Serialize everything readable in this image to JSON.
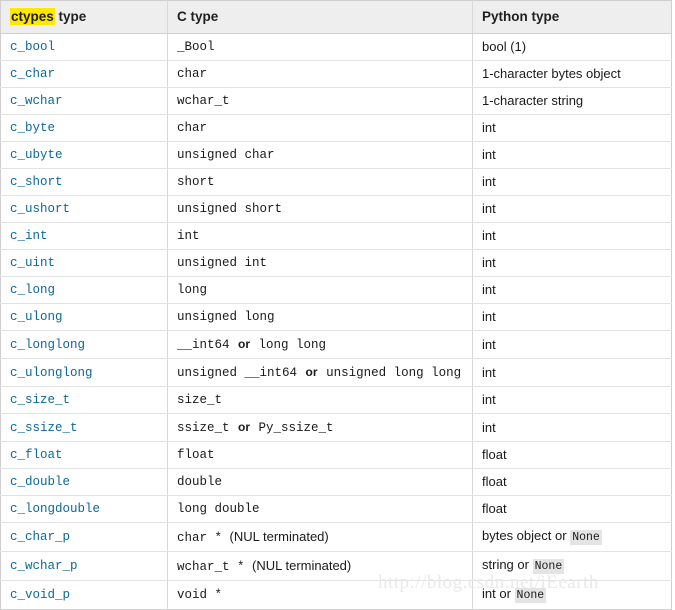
{
  "table": {
    "headers": {
      "col1_highlight": "ctypes",
      "col1_rest": " type",
      "col2": "C type",
      "col3": "Python type"
    },
    "rows": [
      {
        "ctypes": "c_bool",
        "ctype_mono": "_Bool",
        "ctype_or": "",
        "ctype_mono2": "",
        "ctype_plain": "",
        "python": "bool (1)",
        "python_or": "",
        "python_code": ""
      },
      {
        "ctypes": "c_char",
        "ctype_mono": "char",
        "ctype_or": "",
        "ctype_mono2": "",
        "ctype_plain": "",
        "python": "1-character bytes object",
        "python_or": "",
        "python_code": ""
      },
      {
        "ctypes": "c_wchar",
        "ctype_mono": "wchar_t",
        "ctype_or": "",
        "ctype_mono2": "",
        "ctype_plain": "",
        "python": "1-character string",
        "python_or": "",
        "python_code": ""
      },
      {
        "ctypes": "c_byte",
        "ctype_mono": "char",
        "ctype_or": "",
        "ctype_mono2": "",
        "ctype_plain": "",
        "python": "int",
        "python_or": "",
        "python_code": ""
      },
      {
        "ctypes": "c_ubyte",
        "ctype_mono": "unsigned char",
        "ctype_or": "",
        "ctype_mono2": "",
        "ctype_plain": "",
        "python": "int",
        "python_or": "",
        "python_code": ""
      },
      {
        "ctypes": "c_short",
        "ctype_mono": "short",
        "ctype_or": "",
        "ctype_mono2": "",
        "ctype_plain": "",
        "python": "int",
        "python_or": "",
        "python_code": ""
      },
      {
        "ctypes": "c_ushort",
        "ctype_mono": "unsigned short",
        "ctype_or": "",
        "ctype_mono2": "",
        "ctype_plain": "",
        "python": "int",
        "python_or": "",
        "python_code": ""
      },
      {
        "ctypes": "c_int",
        "ctype_mono": "int",
        "ctype_or": "",
        "ctype_mono2": "",
        "ctype_plain": "",
        "python": "int",
        "python_or": "",
        "python_code": ""
      },
      {
        "ctypes": "c_uint",
        "ctype_mono": "unsigned int",
        "ctype_or": "",
        "ctype_mono2": "",
        "ctype_plain": "",
        "python": "int",
        "python_or": "",
        "python_code": ""
      },
      {
        "ctypes": "c_long",
        "ctype_mono": "long",
        "ctype_or": "",
        "ctype_mono2": "",
        "ctype_plain": "",
        "python": "int",
        "python_or": "",
        "python_code": ""
      },
      {
        "ctypes": "c_ulong",
        "ctype_mono": "unsigned long",
        "ctype_or": "",
        "ctype_mono2": "",
        "ctype_plain": "",
        "python": "int",
        "python_or": "",
        "python_code": ""
      },
      {
        "ctypes": "c_longlong",
        "ctype_mono": "__int64",
        "ctype_or": "or",
        "ctype_mono2": "long long",
        "ctype_plain": "",
        "python": "int",
        "python_or": "",
        "python_code": ""
      },
      {
        "ctypes": "c_ulonglong",
        "ctype_mono": "unsigned __int64",
        "ctype_or": "or",
        "ctype_mono2": "unsigned long long",
        "ctype_plain": "",
        "python": "int",
        "python_or": "",
        "python_code": ""
      },
      {
        "ctypes": "c_size_t",
        "ctype_mono": "size_t",
        "ctype_or": "",
        "ctype_mono2": "",
        "ctype_plain": "",
        "python": "int",
        "python_or": "",
        "python_code": ""
      },
      {
        "ctypes": "c_ssize_t",
        "ctype_mono": "ssize_t",
        "ctype_or": "or",
        "ctype_mono2": "Py_ssize_t",
        "ctype_plain": "",
        "python": "int",
        "python_or": "",
        "python_code": ""
      },
      {
        "ctypes": "c_float",
        "ctype_mono": "float",
        "ctype_or": "",
        "ctype_mono2": "",
        "ctype_plain": "",
        "python": "float",
        "python_or": "",
        "python_code": ""
      },
      {
        "ctypes": "c_double",
        "ctype_mono": "double",
        "ctype_or": "",
        "ctype_mono2": "",
        "ctype_plain": "",
        "python": "float",
        "python_or": "",
        "python_code": ""
      },
      {
        "ctypes": "c_longdouble",
        "ctype_mono": "long double",
        "ctype_or": "",
        "ctype_mono2": "",
        "ctype_plain": "",
        "python": "float",
        "python_or": "",
        "python_code": ""
      },
      {
        "ctypes": "c_char_p",
        "ctype_mono": "char *",
        "ctype_or": "",
        "ctype_mono2": "",
        "ctype_plain": "(NUL terminated)",
        "python": "bytes object",
        "python_or": "or",
        "python_code": "None"
      },
      {
        "ctypes": "c_wchar_p",
        "ctype_mono": "wchar_t *",
        "ctype_or": "",
        "ctype_mono2": "",
        "ctype_plain": "(NUL terminated)",
        "python": "string",
        "python_or": "or",
        "python_code": "None"
      },
      {
        "ctypes": "c_void_p",
        "ctype_mono": "void *",
        "ctype_or": "",
        "ctype_mono2": "",
        "ctype_plain": "",
        "python": "int",
        "python_or": "or",
        "python_code": "None"
      }
    ]
  },
  "watermark": {
    "text": "http://blog.csdn.net/iEearth"
  },
  "colors": {
    "link": "#0b6998",
    "highlight": "#ffe800",
    "header_bg": "#eeeeee",
    "code_bg": "#e4e4e4",
    "watermark": "#e9e9e9",
    "border": "#e2e2e2"
  }
}
